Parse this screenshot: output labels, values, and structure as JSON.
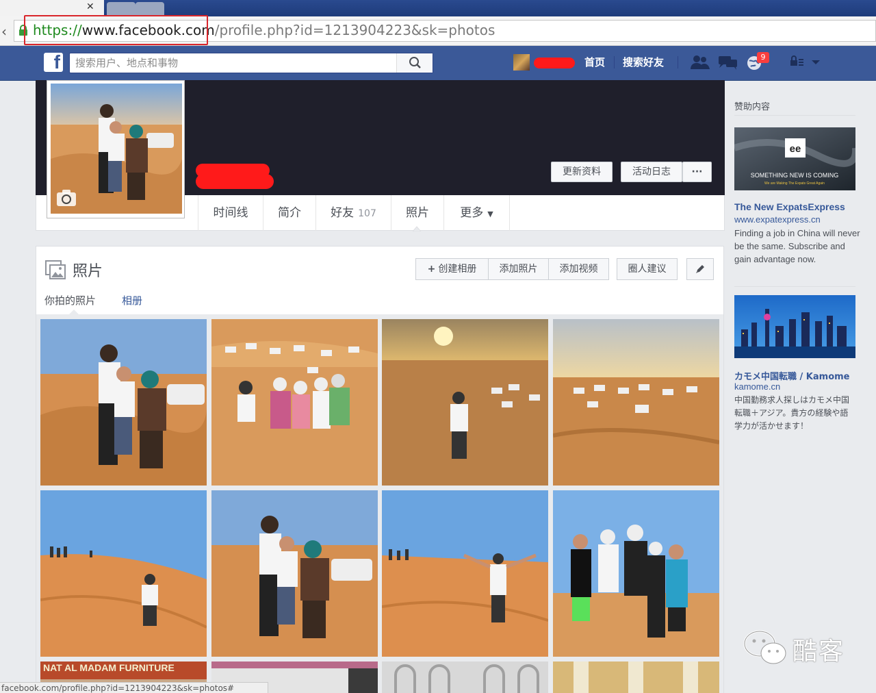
{
  "browser": {
    "url_scheme": "https://",
    "url_host": "www.facebook.com",
    "url_path": "/profile.php?id=1213904223&sk=photos",
    "status_url": "facebook.com/profile.php?id=1213904223&sk=photos#"
  },
  "header": {
    "logo": "f",
    "search_placeholder": "搜索用户、地点和事物",
    "nav": {
      "home": "首页",
      "find_friends": "搜索好友"
    },
    "notification_count": "9"
  },
  "cover": {
    "buttons": {
      "update_info": "更新资料",
      "activity_log": "活动日志",
      "more": "···"
    }
  },
  "profile_tabs": [
    {
      "label": "时间线"
    },
    {
      "label": "简介"
    },
    {
      "label": "好友",
      "count": "107"
    },
    {
      "label": "照片"
    },
    {
      "label": "更多"
    }
  ],
  "photos": {
    "title": "照片",
    "actions": {
      "create_album": "创建相册",
      "add_photos": "添加照片",
      "add_video": "添加视频",
      "circle_suggestions": "圈人建议"
    },
    "subtabs": {
      "yours": "你拍的照片",
      "albums": "相册"
    },
    "grid_caption": "NAT AL MADAM FURNITURE"
  },
  "sidebar": {
    "heading": "赞助内容",
    "ad1": {
      "image_text": "SOMETHING NEW IS COMING",
      "image_subtext": "We are Making The Expats Great Again",
      "image_logo": "ee",
      "title": "The New ExpatsExpress",
      "url": "www.expatexpress.cn",
      "body": "Finding a job in China will never be the same. Subscribe and gain advantage now."
    },
    "ad2": {
      "title": "カモメ中国転職 / Kamome",
      "url": "kamome.cn",
      "body": "中国勤務求人探しはカモメ中国転職＋アジア。貴方の経験や語学力が活かせます！"
    }
  },
  "watermark": {
    "text": "酷客"
  },
  "colors": {
    "fb_blue": "#3b5998",
    "link": "#365899",
    "redaction": "#ff1a1a",
    "highlight": "#d9252b"
  }
}
